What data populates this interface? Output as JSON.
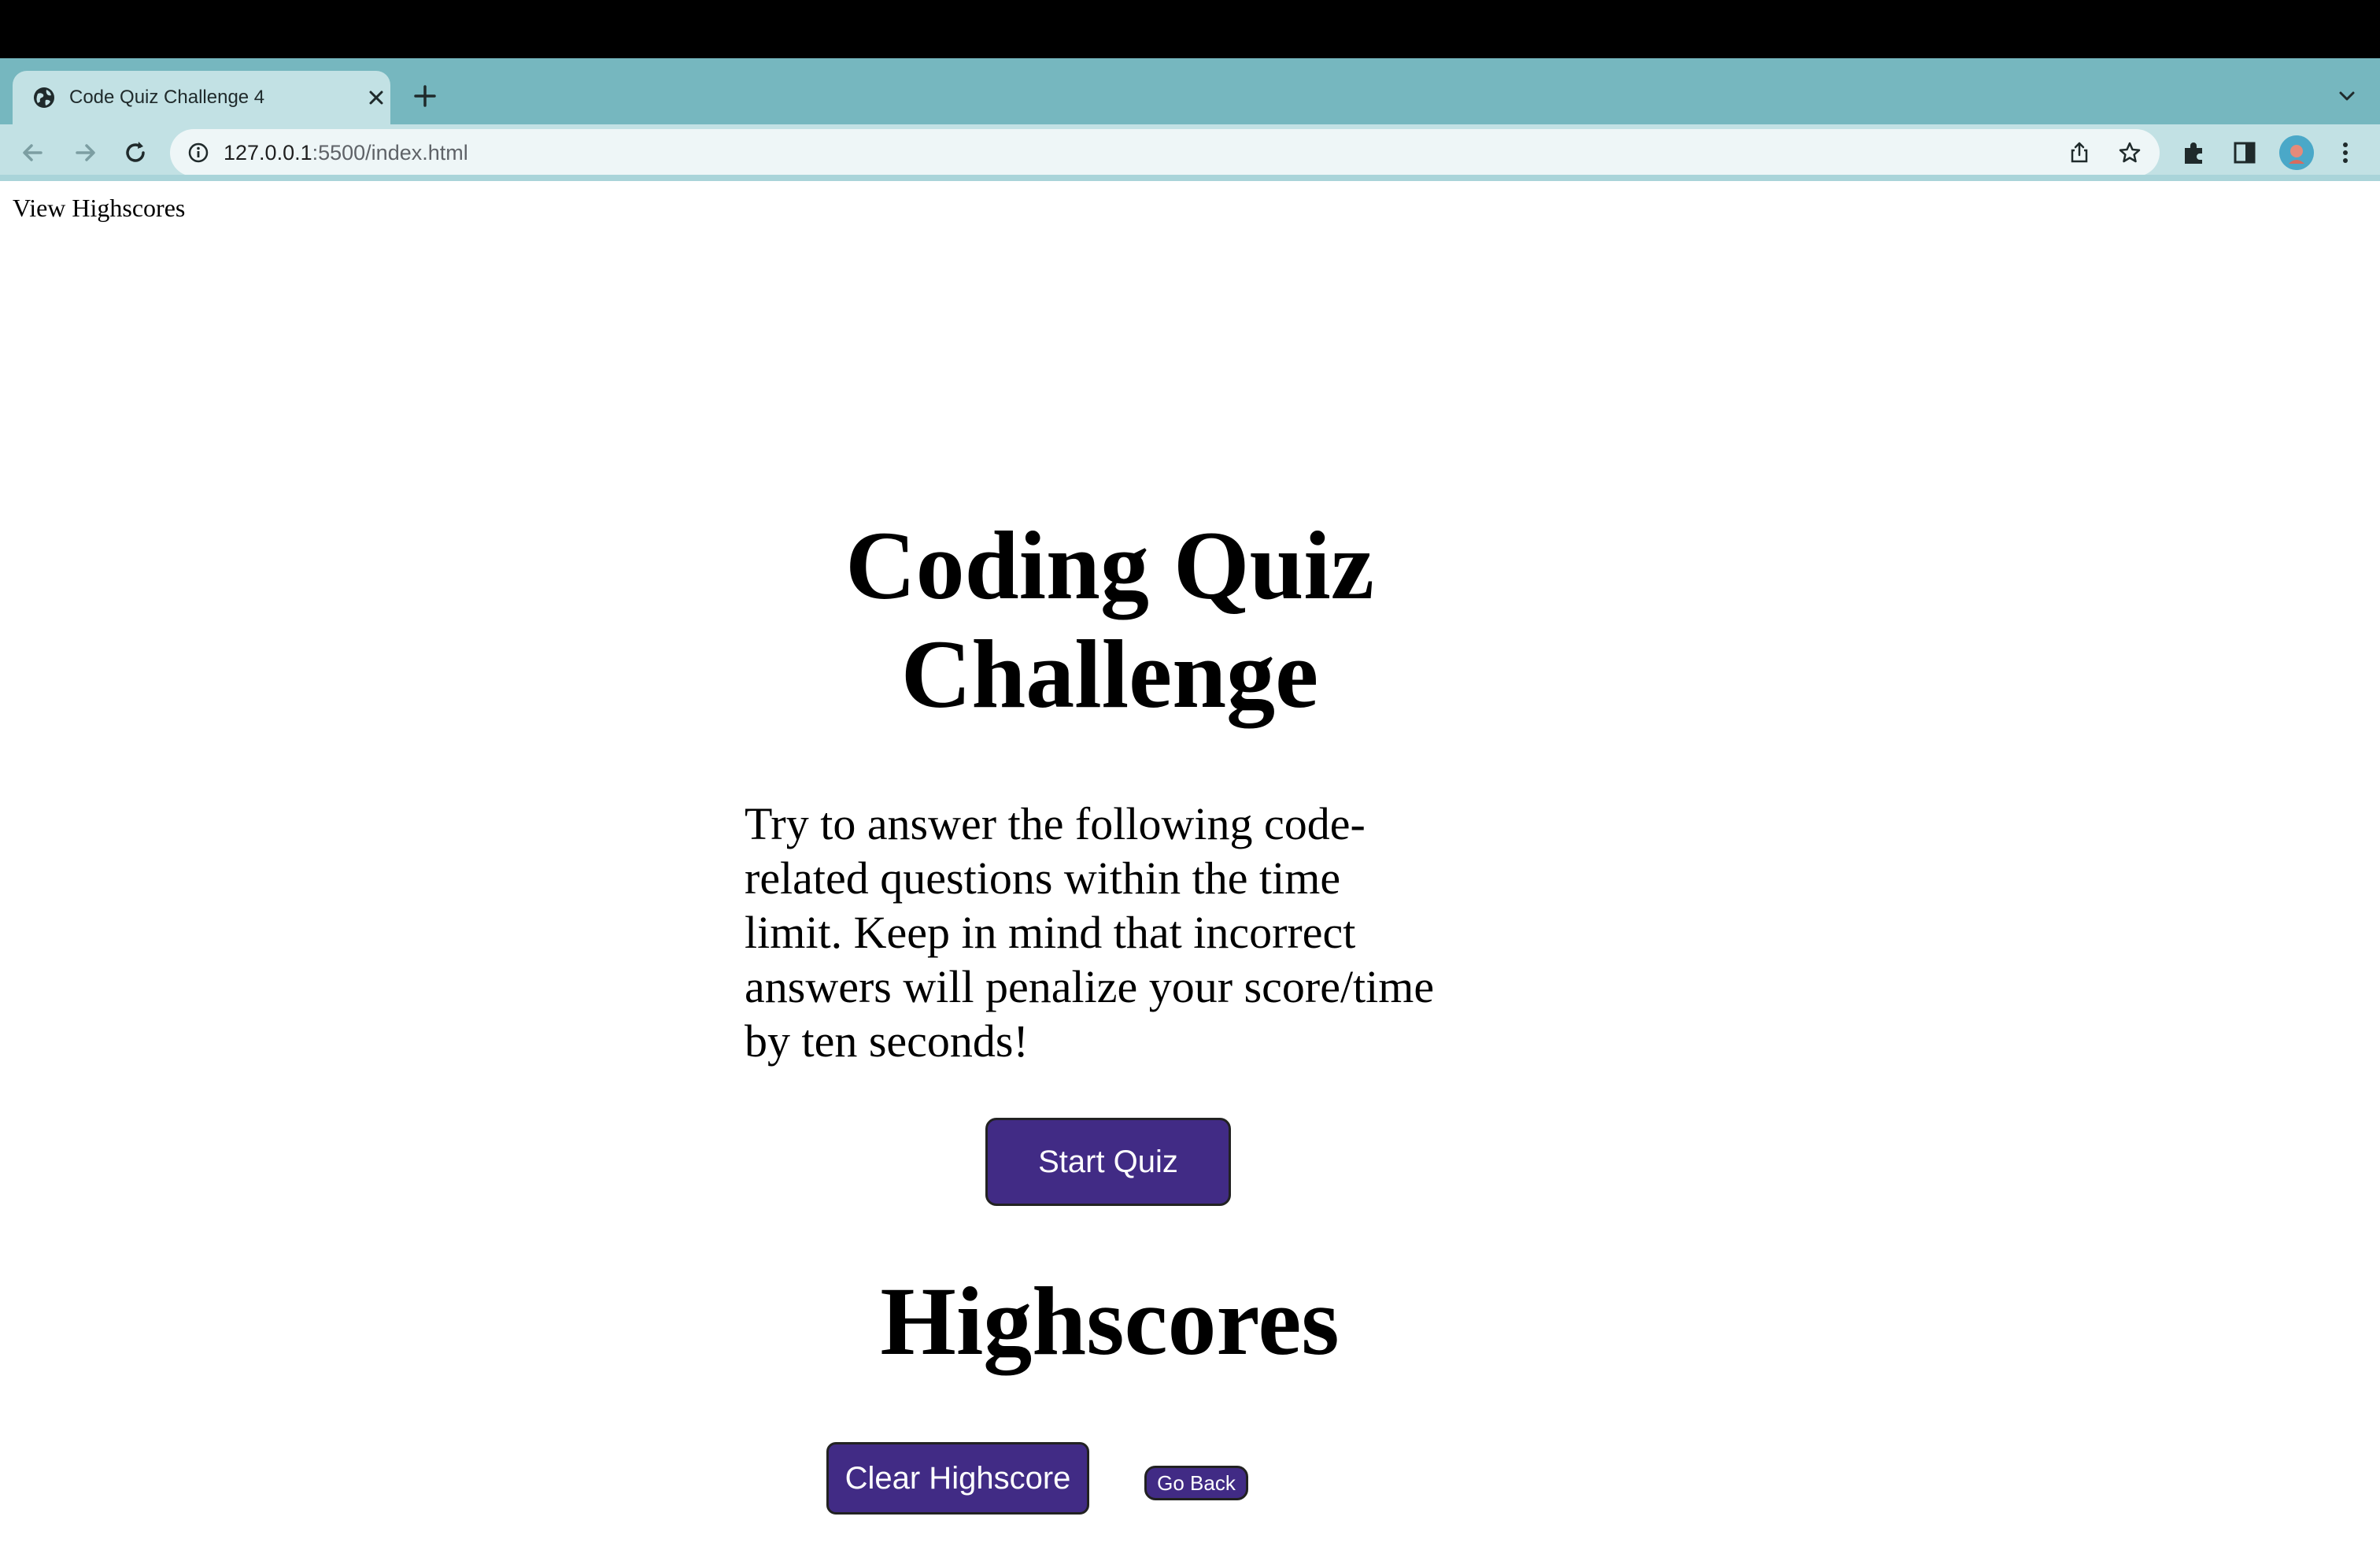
{
  "browser": {
    "tab": {
      "title": "Code Quiz Challenge 4"
    },
    "address": {
      "host": "127.0.0.1",
      "path": ":5500/index.html"
    },
    "colors": {
      "tab_strip": "#76b7bf",
      "toolbar": "#c2e1e4",
      "omnibox": "#eef6f7"
    }
  },
  "header": {
    "view_highscores": "View Highscores"
  },
  "main": {
    "title_line1": "Coding Quiz",
    "title_line2": "Challenge",
    "intro_lines": [
      "Try to answer the following code-",
      "related questions within the time",
      "limit. Keep in mind that incorrect",
      "answers will penalize your score/time",
      "by ten seconds!"
    ],
    "start_button": "Start Quiz"
  },
  "highscores": {
    "title": "Highscores",
    "clear_button": "Clear Highscore",
    "back_button": "Go Back"
  },
  "theme": {
    "button_color": "#412b85"
  }
}
